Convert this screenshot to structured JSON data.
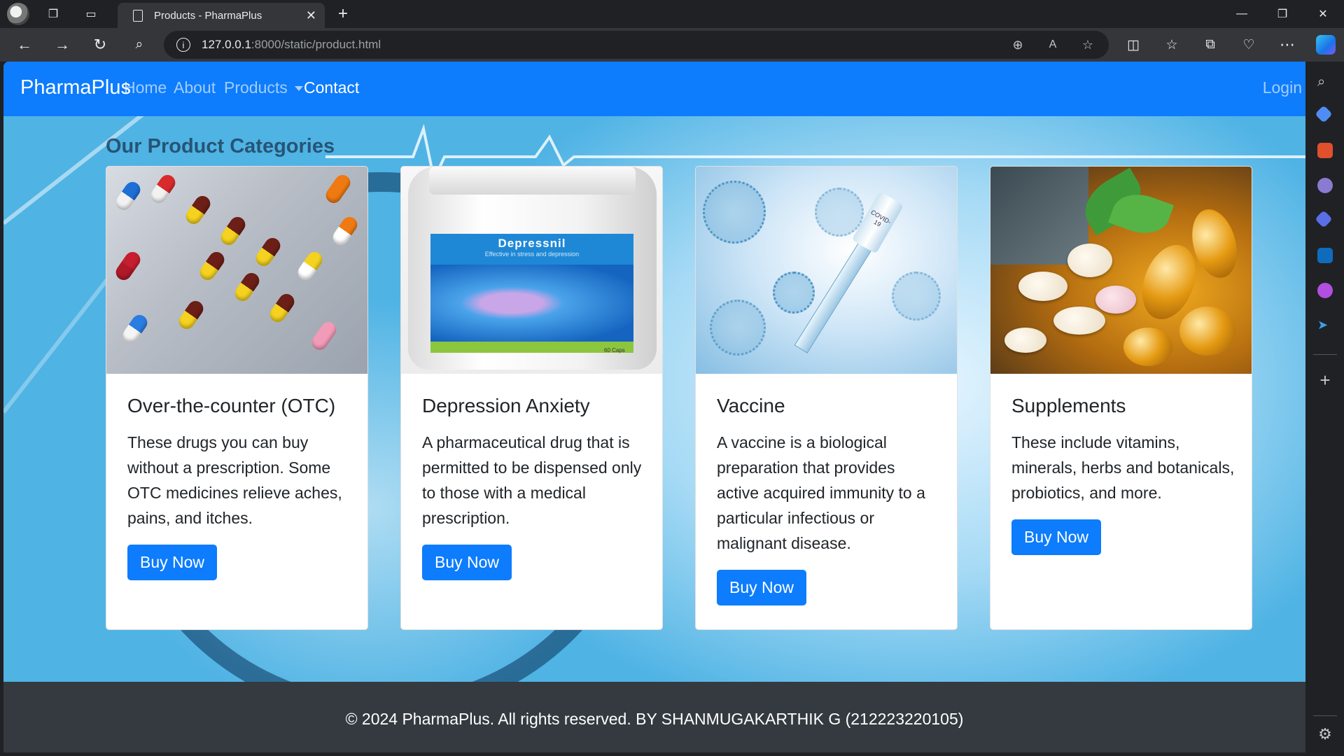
{
  "browser": {
    "tab_title": "Products - PharmaPlus",
    "url_host": "127.0.0.1",
    "url_rest": ":8000/static/product.html"
  },
  "navbar": {
    "brand": "PharmaPlus",
    "links": [
      "Home",
      "About",
      "Products",
      "Contact"
    ],
    "login": "Login"
  },
  "main": {
    "heading": "Our Product Categories",
    "cards": [
      {
        "title": "Over-the-counter (OTC)",
        "text": "These drugs you can buy without a prescription. Some OTC medicines relieve aches, pains, and itches.",
        "button": "Buy Now"
      },
      {
        "title": "Depression Anxiety",
        "text": "A pharmaceutical drug that is permitted to be dispensed only to those with a medical prescription.",
        "button": "Buy Now",
        "image_label": "Depressnil",
        "image_sublabel": "Effective in stress and depression",
        "image_caps": "60 Caps"
      },
      {
        "title": "Vaccine",
        "text": "A vaccine is a biological preparation that provides active acquired immunity to a particular infectious or malignant disease.",
        "button": "Buy Now",
        "image_label": "COVID-19"
      },
      {
        "title": "Supplements",
        "text": "These include vitamins, minerals, herbs and botanicals, probiotics, and more.",
        "button": "Buy Now"
      }
    ]
  },
  "footer": {
    "text": "© 2024 PharmaPlus. All rights reserved. BY SHANMUGAKARTHIK G (212223220105)"
  },
  "colors": {
    "primary": "#0d7cfd",
    "footer_bg": "#343a40",
    "chrome_bg": "#202124"
  }
}
